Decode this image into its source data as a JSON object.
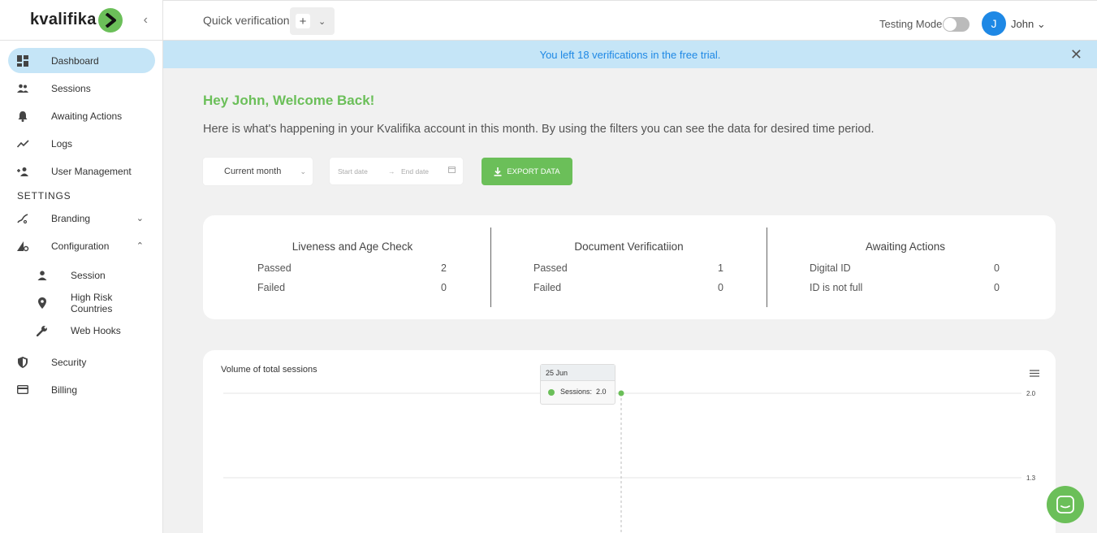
{
  "brand": {
    "name": "kvalifika"
  },
  "header": {
    "quick_verification": "Quick verification",
    "testing_mode": "Testing Mode",
    "user_initial": "J",
    "user_name": "John"
  },
  "banner": {
    "text": "You left 18 verifications in the free trial."
  },
  "sidebar": {
    "items": [
      {
        "label": "Dashboard",
        "icon": "dashboard-icon"
      },
      {
        "label": "Sessions",
        "icon": "people-icon"
      },
      {
        "label": "Awaiting Actions",
        "icon": "bell-icon"
      },
      {
        "label": "Logs",
        "icon": "trend-icon"
      },
      {
        "label": "User Management",
        "icon": "add-user-icon"
      }
    ],
    "settings_label": "SETTINGS",
    "settings": [
      {
        "label": "Branding",
        "icon": "brush-icon"
      },
      {
        "label": "Configuration",
        "icon": "config-icon"
      }
    ],
    "config_sub": [
      {
        "label": "Session",
        "icon": "person-icon"
      },
      {
        "label": "High Risk Countries",
        "icon": "pin-icon"
      },
      {
        "label": "Web Hooks",
        "icon": "wrench-icon"
      }
    ],
    "bottom": [
      {
        "label": "Security",
        "icon": "shield-icon"
      },
      {
        "label": "Billing",
        "icon": "card-icon"
      }
    ]
  },
  "main": {
    "welcome": "Hey John, Welcome Back!",
    "intro": "Here is what's happening in your Kvalifika account in this month. By using the filters you can see the data for desired time period.",
    "period": "Current month",
    "start_date_placeholder": "Start date",
    "end_date_placeholder": "End date",
    "export_label": "EXPORT DATA"
  },
  "stats": {
    "liveness": {
      "title": "Liveness and Age Check",
      "rows": [
        {
          "label": "Passed",
          "value": "2"
        },
        {
          "label": "Failed",
          "value": "0"
        }
      ]
    },
    "document": {
      "title": "Document Verificatiion",
      "rows": [
        {
          "label": "Passed",
          "value": "1"
        },
        {
          "label": "Failed",
          "value": "0"
        }
      ]
    },
    "awaiting": {
      "title": "Awaiting Actions",
      "rows": [
        {
          "label": "Digital ID",
          "value": "0"
        },
        {
          "label": "ID is not full",
          "value": "0"
        }
      ]
    }
  },
  "chart_data": {
    "type": "line",
    "title": "Volume of total sessions",
    "y_ticks": [
      "2.0",
      "1.3"
    ],
    "series": [
      {
        "name": "Sessions",
        "points": [
          {
            "x": "25 Jun",
            "y": 2.0
          }
        ]
      }
    ],
    "tooltip": {
      "date": "25 Jun",
      "label": "Sessions:",
      "value": "2.0"
    },
    "grid": true,
    "accent": "#6bbf59"
  },
  "colors": {
    "accent": "#6bbf59",
    "banner_bg": "#c5e5f7",
    "link": "#1e88e5"
  }
}
